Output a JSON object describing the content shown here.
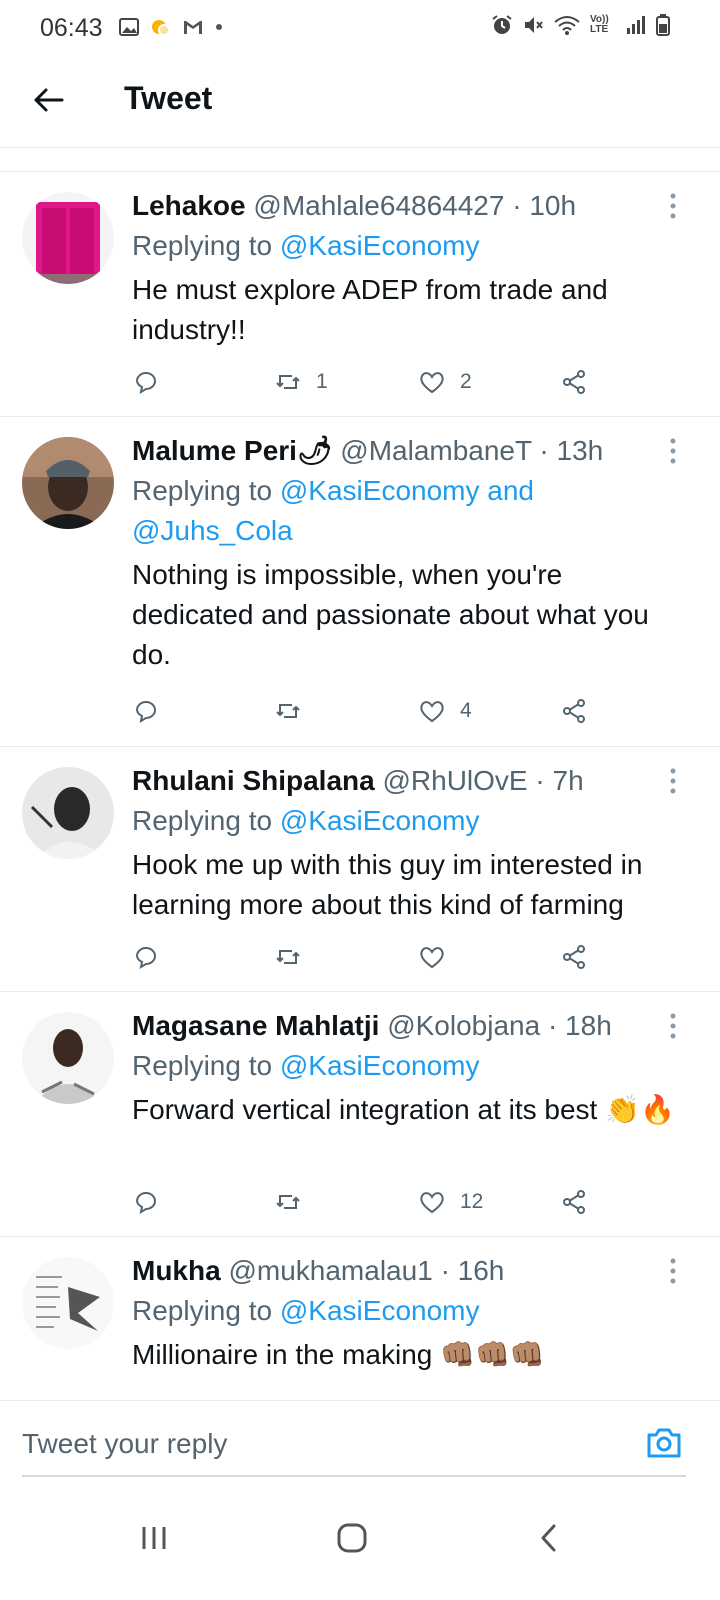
{
  "status_bar": {
    "time": "06:43",
    "left_icons": [
      "gallery-icon",
      "weather-icon",
      "gmail-icon",
      "dot-icon"
    ],
    "right_icons": [
      "alarm-icon",
      "mute-icon",
      "wifi-icon",
      "volte-icon",
      "signal-icon",
      "battery-icon"
    ],
    "volte_text": "Vo)) LTE"
  },
  "header": {
    "title": "Tweet"
  },
  "tweets": [
    {
      "name": "Lehakoe",
      "handle": "@Mahlale64864427",
      "time": "· 10h",
      "reply_prefix": "Replying to ",
      "reply_mentions": "@KasiEconomy",
      "text": "He must explore ADEP from trade and industry!!",
      "retweets": "1",
      "likes": "2"
    },
    {
      "name": "Malume Peri🌶",
      "handle": "@MalambaneT",
      "time": "· 13h",
      "reply_prefix": "Replying to ",
      "reply_mentions": "@KasiEconomy and @Juhs_Cola",
      "text": "Nothing is impossible, when you're dedicated and passionate about what you do.",
      "retweets": "",
      "likes": "4"
    },
    {
      "name": "Rhulani Shipalana",
      "handle": "@RhUlOvE",
      "time": "· 7h",
      "reply_prefix": "Replying to ",
      "reply_mentions": "@KasiEconomy",
      "text": "Hook me up with this guy im interested in learning more about this kind of farming",
      "retweets": "",
      "likes": ""
    },
    {
      "name": "Magasane Mahlatji",
      "handle": "@Kolobjana",
      "time": "· 18h",
      "reply_prefix": "Replying to ",
      "reply_mentions": "@KasiEconomy",
      "text": "Forward vertical integration at its best 👏🔥",
      "retweets": "",
      "likes": "12"
    },
    {
      "name": "Mukha",
      "handle": "@mukhamalau1",
      "time": "· 16h",
      "reply_prefix": "Replying to ",
      "reply_mentions": "@KasiEconomy",
      "text": "Millionaire in the making 👊🏽👊🏽👊🏽",
      "retweets": "",
      "likes": ""
    }
  ],
  "compose": {
    "placeholder": "Tweet your reply"
  },
  "colors": {
    "accent": "#1d9bf0",
    "secondary_text": "#536471",
    "primary_text": "#0f1419",
    "divider": "#e6ecf0"
  }
}
